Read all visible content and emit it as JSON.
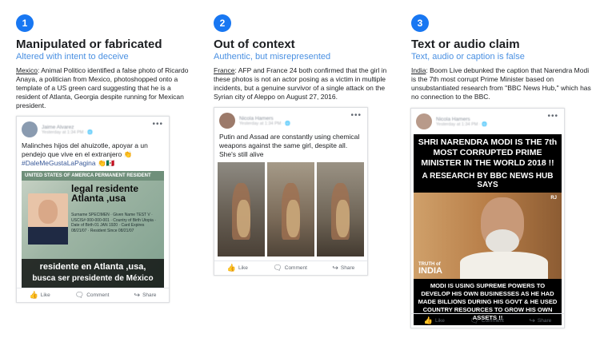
{
  "columns": [
    {
      "number": "1",
      "title": "Manipulated or fabricated",
      "subtitle": "Altered with intent to deceive",
      "source": "Mexico",
      "description": ": Animal Politico identified a false photo of Ricardo Anaya, a politician from Mexico, photoshopped onto a template of a US green card suggesting that he is a resident of Atlanta, Georgia despite running for Mexican president."
    },
    {
      "number": "2",
      "title": "Out of context",
      "subtitle": "Authentic, but misrepresented",
      "source": "France",
      "description": ": AFP and France 24 both confirmed that the girl in these photos is not an actor posing as a victim in multiple incidents, but a genuine survivor of a single attack on the Syrian city of Aleppo on August 27, 2016."
    },
    {
      "number": "3",
      "title": "Text or audio claim",
      "subtitle": "Text, audio or caption is false",
      "source": "India",
      "description": ": Boom Live debunked the caption that Narendra Modi is the 7th most corrupt Prime Minister based on unsubstantiated research from \"BBC News Hub,\" which has no connection to the BBC."
    }
  ],
  "posts": {
    "p1": {
      "author": "Jaime Alvarez",
      "time": "Yesterday at 1:34 PM · 🌐",
      "text": "Malinches hijos del ahuizotle, apoyar a un pendejo que vive en el extranjero 👏",
      "hashtag": "#DaleMeGustaLaPagina 👏🇲🇽",
      "card_bar": "UNITED STATES OF AMERICA   PERMANENT RESIDENT",
      "card_big": "legal residente Atlanta ,usa",
      "card_small": "Surname SPECIMEN · Given Name TEST V · USCIS# 000-000-001 · Country of Birth Utopia · Date of Birth 01 JAN 1920 · Card Expires 08/21/07 · Resident Since 08/21/07",
      "card_caption1": "residente en Atlanta ,usa,",
      "card_caption2": "busca ser presidente de México"
    },
    "p2": {
      "author": "Nicola Hamers",
      "time": "Yesterday at 1:34 PM · 🌐",
      "text": "Putin and Assad are constantly using chemical weapons against the same girl, despite all. She's still alive"
    },
    "p3": {
      "author": "Nicola Hamers",
      "time": "Yesterday at 1:34 PM · 🌐",
      "head1": "SHRI NARENDRA MODI IS THE 7th MOST CORRUPTED PRIME MINISTER IN THE WORLD 2018 !!",
      "head2": "A RESEARCH BY BBC NEWS HUB SAYS",
      "rj": "RJ",
      "toi_small": "TRUTH of",
      "toi_big": "INDIA",
      "foot": "MODI IS USING SUPREME POWERS TO DEVELOP HIS OWN BUSINESSES AS HE HAD MADE BILLIONS DURING HIS GOVT & HE USED COUNTRY RESOURCES TO GROW HIS OWN ASSETS !!"
    }
  },
  "actions": {
    "like": "Like",
    "comment": "Comment",
    "share": "Share"
  },
  "colors": {
    "accent": "#1877f2",
    "subtitle": "#4a90e2"
  }
}
